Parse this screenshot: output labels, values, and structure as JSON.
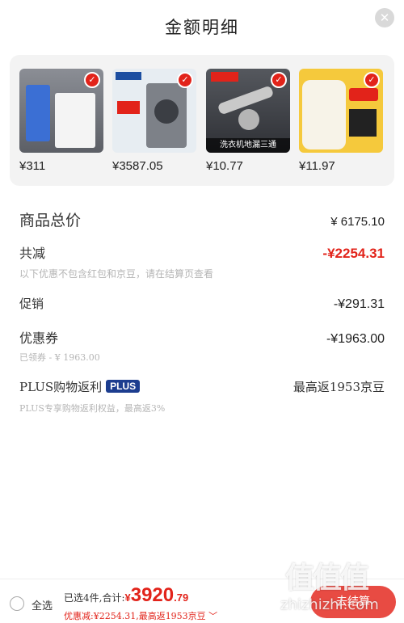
{
  "header": {
    "title": "金额明细",
    "close_icon": "close-icon"
  },
  "products": [
    {
      "price": "¥311",
      "thumb_color": "#6a6d73",
      "icon": "washing-machine-image"
    },
    {
      "price": "¥3587.05",
      "thumb_color": "#e7edf2",
      "icon": "washing-machine-image"
    },
    {
      "price": "¥10.77",
      "thumb_color": "#3a3d42",
      "icon": "floor-drain-image",
      "caption": "洗衣机地漏三通"
    },
    {
      "price": "¥11.97",
      "thumb_color": "#f5c93c",
      "icon": "dust-cover-image"
    }
  ],
  "summary_rows": {
    "goods_total_label": "商品总价",
    "goods_total_value": "¥ 6175.10",
    "total_discount_label": "共减",
    "total_discount_value": "-¥2254.31",
    "discount_note": "以下优惠不包含红包和京豆，请在结算页查看",
    "promo_label": "促销",
    "promo_value": "-¥291.31",
    "coupon_label": "优惠券",
    "coupon_value": "-¥1963.00",
    "coupon_note": "已领券 - ¥ 1963.00",
    "plus_label": "PLUS购物返利",
    "plus_badge": "PLUS",
    "plus_value": "最高返1953京豆",
    "plus_note": "PLUS专享购物返利权益，最高返3%"
  },
  "bottom_bar": {
    "select_all": "全选",
    "selected_prefix": "已选4件,合计:",
    "total_currency": "¥",
    "total_int": "3920",
    "total_dec": ".79",
    "discount_line": "优惠减:¥2254.31,最高返1953京豆 ﹀",
    "checkout": "去结算"
  },
  "watermark": {
    "logo": "值值值",
    "text": "zhizhizhi.com"
  },
  "colors": {
    "accent": "#e2231a",
    "plus_badge": "#1c3d8f",
    "button": "#e84b43"
  }
}
